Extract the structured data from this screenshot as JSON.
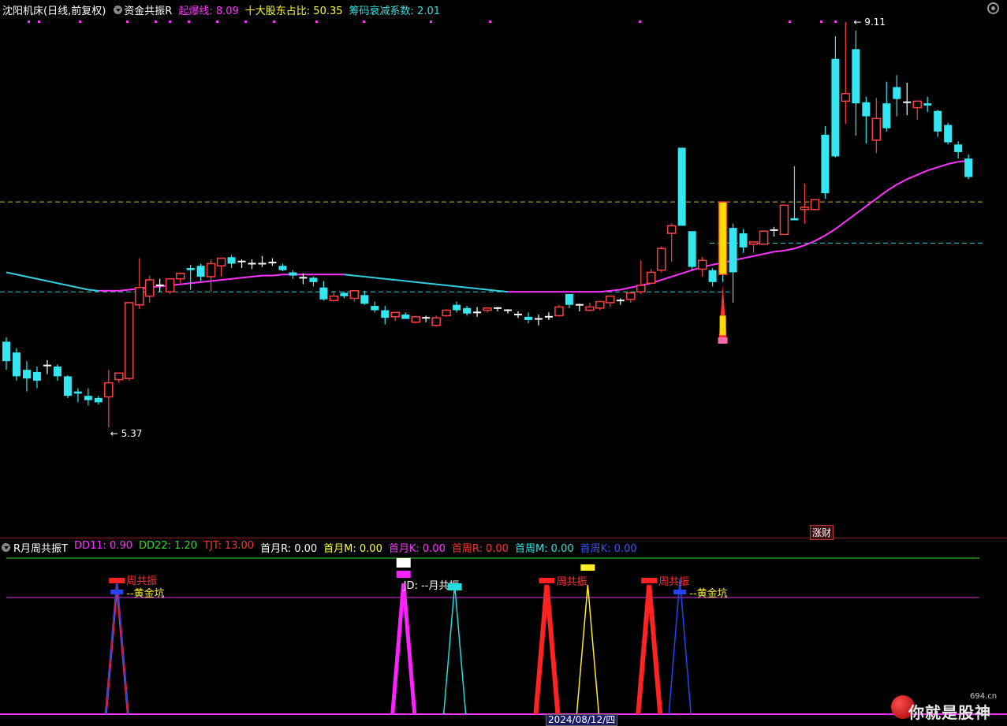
{
  "header": {
    "stock": "沈阳机床(日线,前复权)",
    "indicator": "资金共振R",
    "items": [
      {
        "label": "起爆线: 8.09",
        "color": "#ff33ff"
      },
      {
        "label": "十大股东占比: 50.35",
        "color": "#ffff33"
      },
      {
        "label": "筹码衰减系数: 2.01",
        "color": "#33e0e0"
      }
    ]
  },
  "price_chart": {
    "high_label": "9.11",
    "low_label": "5.37",
    "badge": "涨财"
  },
  "sub_header": {
    "name": "R月周共振T",
    "items": [
      {
        "label": "DD11: 0.90",
        "color": "#ff33ff"
      },
      {
        "label": "DD22: 1.20",
        "color": "#33dd33"
      },
      {
        "label": "TJT: 13.00",
        "color": "#ff3333"
      },
      {
        "label": "首月R: 0.00",
        "color": "#ffffff"
      },
      {
        "label": "首月M: 0.00",
        "color": "#ffff33"
      },
      {
        "label": "首月K: 0.00",
        "color": "#ff33ff"
      },
      {
        "label": "首周R: 0.00",
        "color": "#ff3333"
      },
      {
        "label": "首周M: 0.00",
        "color": "#33e0e0"
      },
      {
        "label": "首周K: 0.00",
        "color": "#3355ff"
      }
    ]
  },
  "signals": {
    "week_resonance": "周共振",
    "golden_pit": "黄金坑",
    "month_resonance": "JD: --月共振"
  },
  "footer": {
    "date": "2024/08/12/四",
    "logo_text": "你就是股神",
    "site": "694.cn"
  },
  "chart_data": {
    "type": "candlestick",
    "candles": [
      [
        6.16,
        6.2,
        5.98,
        5.9
      ],
      [
        6.06,
        6.1,
        5.84,
        5.8
      ],
      [
        5.9,
        5.98,
        5.82,
        5.7
      ],
      [
        5.88,
        5.93,
        5.8,
        5.73
      ],
      [
        5.93,
        5.99,
        5.94,
        5.86
      ],
      [
        5.93,
        5.95,
        5.84,
        5.8
      ],
      [
        5.84,
        5.85,
        5.66,
        5.64
      ],
      [
        5.7,
        5.73,
        5.68,
        5.6
      ],
      [
        5.66,
        5.73,
        5.62,
        5.57
      ],
      [
        5.64,
        5.66,
        5.6,
        5.58
      ],
      [
        5.65,
        5.9,
        5.78,
        5.37
      ],
      [
        5.81,
        5.86,
        5.87,
        5.78
      ],
      [
        5.82,
        5.92,
        6.52,
        5.8
      ],
      [
        6.5,
        6.93,
        6.66,
        6.46
      ],
      [
        6.58,
        6.77,
        6.73,
        6.52
      ],
      [
        6.68,
        6.74,
        6.68,
        6.62
      ],
      [
        6.62,
        6.74,
        6.74,
        6.6
      ],
      [
        6.74,
        6.8,
        6.79,
        6.7
      ],
      [
        6.84,
        6.87,
        6.82,
        6.64
      ],
      [
        6.86,
        6.88,
        6.76,
        6.72
      ],
      [
        6.76,
        6.92,
        6.88,
        6.62
      ],
      [
        6.86,
        6.93,
        6.93,
        6.76
      ],
      [
        6.94,
        6.96,
        6.88,
        6.84
      ],
      [
        6.9,
        6.92,
        6.9,
        6.84
      ],
      [
        6.88,
        6.92,
        6.88,
        6.83
      ],
      [
        6.88,
        6.95,
        6.88,
        6.85
      ],
      [
        6.89,
        6.93,
        6.89,
        6.86
      ],
      [
        6.86,
        6.88,
        6.82,
        6.81
      ],
      [
        6.8,
        6.82,
        6.77,
        6.74
      ],
      [
        6.74,
        6.79,
        6.75,
        6.69
      ],
      [
        6.75,
        6.76,
        6.71,
        6.67
      ],
      [
        6.66,
        6.72,
        6.55,
        6.54
      ],
      [
        6.54,
        6.63,
        6.58,
        6.53
      ],
      [
        6.61,
        6.62,
        6.58,
        6.56
      ],
      [
        6.56,
        6.63,
        6.63,
        6.53
      ],
      [
        6.59,
        6.63,
        6.51,
        6.5
      ],
      [
        6.49,
        6.53,
        6.45,
        6.43
      ],
      [
        6.45,
        6.49,
        6.38,
        6.32
      ],
      [
        6.39,
        6.43,
        6.43,
        6.35
      ],
      [
        6.41,
        6.43,
        6.37,
        6.37
      ],
      [
        6.34,
        6.4,
        6.39,
        6.33
      ],
      [
        6.37,
        6.4,
        6.38,
        6.34
      ],
      [
        6.31,
        6.4,
        6.38,
        6.3
      ],
      [
        6.4,
        6.46,
        6.45,
        6.39
      ],
      [
        6.5,
        6.53,
        6.45,
        6.43
      ],
      [
        6.47,
        6.49,
        6.42,
        6.4
      ],
      [
        6.43,
        6.48,
        6.43,
        6.39
      ],
      [
        6.45,
        6.48,
        6.47,
        6.43
      ],
      [
        6.47,
        6.48,
        6.47,
        6.44
      ],
      [
        6.45,
        6.46,
        6.45,
        6.42
      ],
      [
        6.41,
        6.44,
        6.41,
        6.38
      ],
      [
        6.39,
        6.43,
        6.36,
        6.33
      ],
      [
        6.37,
        6.41,
        6.37,
        6.31
      ],
      [
        6.39,
        6.43,
        6.39,
        6.36
      ],
      [
        6.4,
        6.5,
        6.48,
        6.39
      ],
      [
        6.6,
        6.6,
        6.5,
        6.47
      ],
      [
        6.5,
        6.51,
        6.5,
        6.44
      ],
      [
        6.45,
        6.52,
        6.48,
        6.44
      ],
      [
        6.47,
        6.52,
        6.53,
        6.45
      ],
      [
        6.52,
        6.57,
        6.58,
        6.48
      ],
      [
        6.54,
        6.56,
        6.53,
        6.5
      ],
      [
        6.55,
        6.62,
        6.61,
        6.52
      ],
      [
        6.62,
        6.91,
        6.68,
        6.6
      ],
      [
        6.7,
        6.83,
        6.8,
        6.7
      ],
      [
        6.82,
        7.04,
        7.02,
        6.8
      ],
      [
        7.16,
        7.25,
        7.23,
        6.9
      ],
      [
        7.95,
        7.95,
        7.23,
        7.23
      ],
      [
        7.18,
        7.18,
        6.85,
        6.82
      ],
      [
        6.83,
        6.94,
        6.91,
        6.76
      ],
      [
        6.82,
        6.84,
        6.71,
        6.67
      ],
      [
        6.88,
        6.96,
        6.86,
        6.71
      ],
      [
        7.21,
        7.25,
        6.8,
        6.52
      ],
      [
        7.16,
        7.2,
        7.03,
        6.98
      ],
      [
        7.06,
        7.07,
        7.08,
        6.98
      ],
      [
        7.06,
        7.18,
        7.18,
        7.06
      ],
      [
        7.18,
        7.22,
        7.19,
        7.13
      ],
      [
        7.15,
        7.28,
        7.42,
        7.15
      ],
      [
        7.3,
        7.78,
        7.28,
        7.28
      ],
      [
        7.38,
        7.62,
        7.4,
        7.25
      ],
      [
        7.38,
        7.38,
        7.47,
        7.38
      ],
      [
        8.07,
        8.15,
        7.53,
        7.48
      ],
      [
        8.77,
        8.98,
        7.87,
        7.86
      ],
      [
        8.38,
        9.11,
        8.45,
        8.17
      ],
      [
        8.86,
        9.03,
        8.36,
        8.06
      ],
      [
        8.37,
        8.42,
        8.24,
        7.99
      ],
      [
        8.02,
        8.41,
        8.22,
        7.9
      ],
      [
        8.36,
        8.56,
        8.13,
        8.1
      ],
      [
        8.51,
        8.62,
        8.4,
        8.24
      ],
      [
        8.37,
        8.55,
        8.37,
        8.25
      ],
      [
        8.32,
        8.34,
        8.38,
        8.21
      ],
      [
        8.36,
        8.42,
        8.34,
        8.28
      ],
      [
        8.29,
        8.3,
        8.1,
        8.05
      ],
      [
        8.16,
        8.18,
        8.0,
        7.98
      ],
      [
        7.98,
        8.01,
        7.91,
        7.85
      ],
      [
        7.85,
        7.89,
        7.68,
        7.66
      ]
    ],
    "ma_line": [
      6.8,
      6.78,
      6.76,
      6.74,
      6.72,
      6.7,
      6.68,
      6.66,
      6.64,
      6.63,
      6.63,
      6.63,
      6.64,
      6.65,
      6.66,
      6.67,
      6.68,
      6.69,
      6.7,
      6.71,
      6.72,
      6.73,
      6.74,
      6.75,
      6.76,
      6.77,
      6.77,
      6.78,
      6.78,
      6.78,
      6.78,
      6.78,
      6.78,
      6.78,
      6.77,
      6.76,
      6.75,
      6.74,
      6.73,
      6.72,
      6.71,
      6.7,
      6.69,
      6.68,
      6.67,
      6.66,
      6.65,
      6.64,
      6.63,
      6.62,
      6.62,
      6.62,
      6.62,
      6.62,
      6.62,
      6.62,
      6.62,
      6.62,
      6.62,
      6.63,
      6.64,
      6.66,
      6.68,
      6.7,
      6.73,
      6.76,
      6.79,
      6.82,
      6.85,
      6.87,
      6.89,
      6.91,
      6.93,
      6.95,
      6.97,
      6.99,
      7.0,
      7.02,
      7.05,
      7.09,
      7.14,
      7.2,
      7.27,
      7.34,
      7.41,
      7.48,
      7.55,
      7.61,
      7.66,
      7.7,
      7.74,
      7.77,
      7.8,
      7.82,
      7.83
    ],
    "hlines": {
      "yellow_dashed": 7.45,
      "cyan_dashed_high": 7.07,
      "cyan_dashed_low": 6.62
    },
    "sub_signals": {
      "red_x": [
        10.5,
        52.5,
        62.5
      ],
      "magenta_x": [
        38.5
      ],
      "cyan_x": [
        43.5
      ],
      "yellow_x": [
        56.5
      ],
      "blue_x": [
        10.5,
        65.5
      ]
    }
  }
}
